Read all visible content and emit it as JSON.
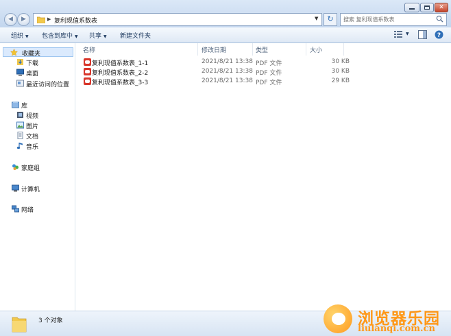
{
  "window": {
    "address_path": "复利现值系数表",
    "search_placeholder": "搜索 复利现值系数表"
  },
  "toolbar": {
    "organize": "组织",
    "include_in_library": "包含到库中",
    "share": "共享",
    "new_folder": "新建文件夹"
  },
  "nav": {
    "favorites": "收藏夹",
    "downloads": "下载",
    "desktop": "桌面",
    "recent": "最近访问的位置",
    "libraries": "库",
    "videos": "视频",
    "pictures": "图片",
    "documents": "文档",
    "music": "音乐",
    "homegroup": "家庭组",
    "computer": "计算机",
    "network": "网络"
  },
  "columns": {
    "name": "名称",
    "date": "修改日期",
    "type": "类型",
    "size": "大小"
  },
  "files": [
    {
      "name": "复利现值系数表_1-1",
      "date": "2021/8/21 13:38",
      "type": "PDF 文件",
      "size": "30 KB"
    },
    {
      "name": "复利现值系数表_2-2",
      "date": "2021/8/21 13:38",
      "type": "PDF 文件",
      "size": "30 KB"
    },
    {
      "name": "复利现值系数表_3-3",
      "date": "2021/8/21 13:38",
      "type": "PDF 文件",
      "size": "29 KB"
    }
  ],
  "status": {
    "item_count": "3 个对象"
  },
  "watermark": {
    "cn": "浏览器乐园",
    "en": "liulanqi.com.cn"
  },
  "colors": {
    "accent": "#2f6fb7",
    "pdf": "#d8362b",
    "watermark": "#ff9818"
  }
}
